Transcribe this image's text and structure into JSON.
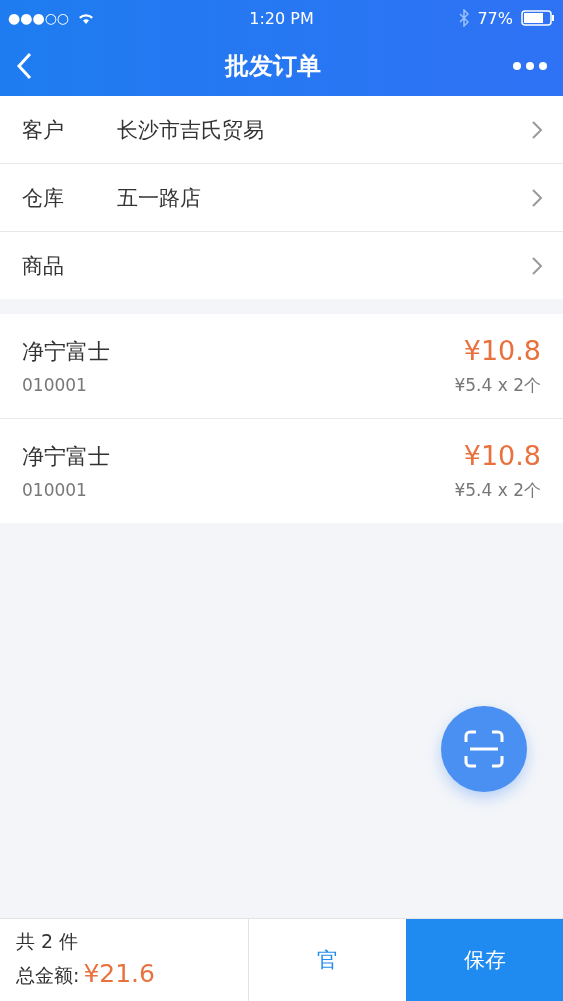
{
  "status_bar": {
    "signal": "●●●○○",
    "time": "1:20 PM",
    "battery": "77%"
  },
  "nav": {
    "title": "批发订单"
  },
  "fields": [
    {
      "label": "客户",
      "value": "长沙市吉氏贸易"
    },
    {
      "label": "仓库",
      "value": "五一路店"
    },
    {
      "label": "商品"
    }
  ],
  "items": [
    {
      "name": "净宁富士",
      "code": "010001",
      "total": "¥10.8",
      "unit": "¥5.4 x 2个"
    },
    {
      "name": "净宁富士",
      "code": "010001",
      "total": "¥10.8",
      "unit": "¥5.4 x 2个"
    }
  ],
  "footer": {
    "count": "共 2 件",
    "total_label": "总金额:",
    "total": "¥21.6",
    "buttons": [
      "官",
      "保存"
    ]
  }
}
